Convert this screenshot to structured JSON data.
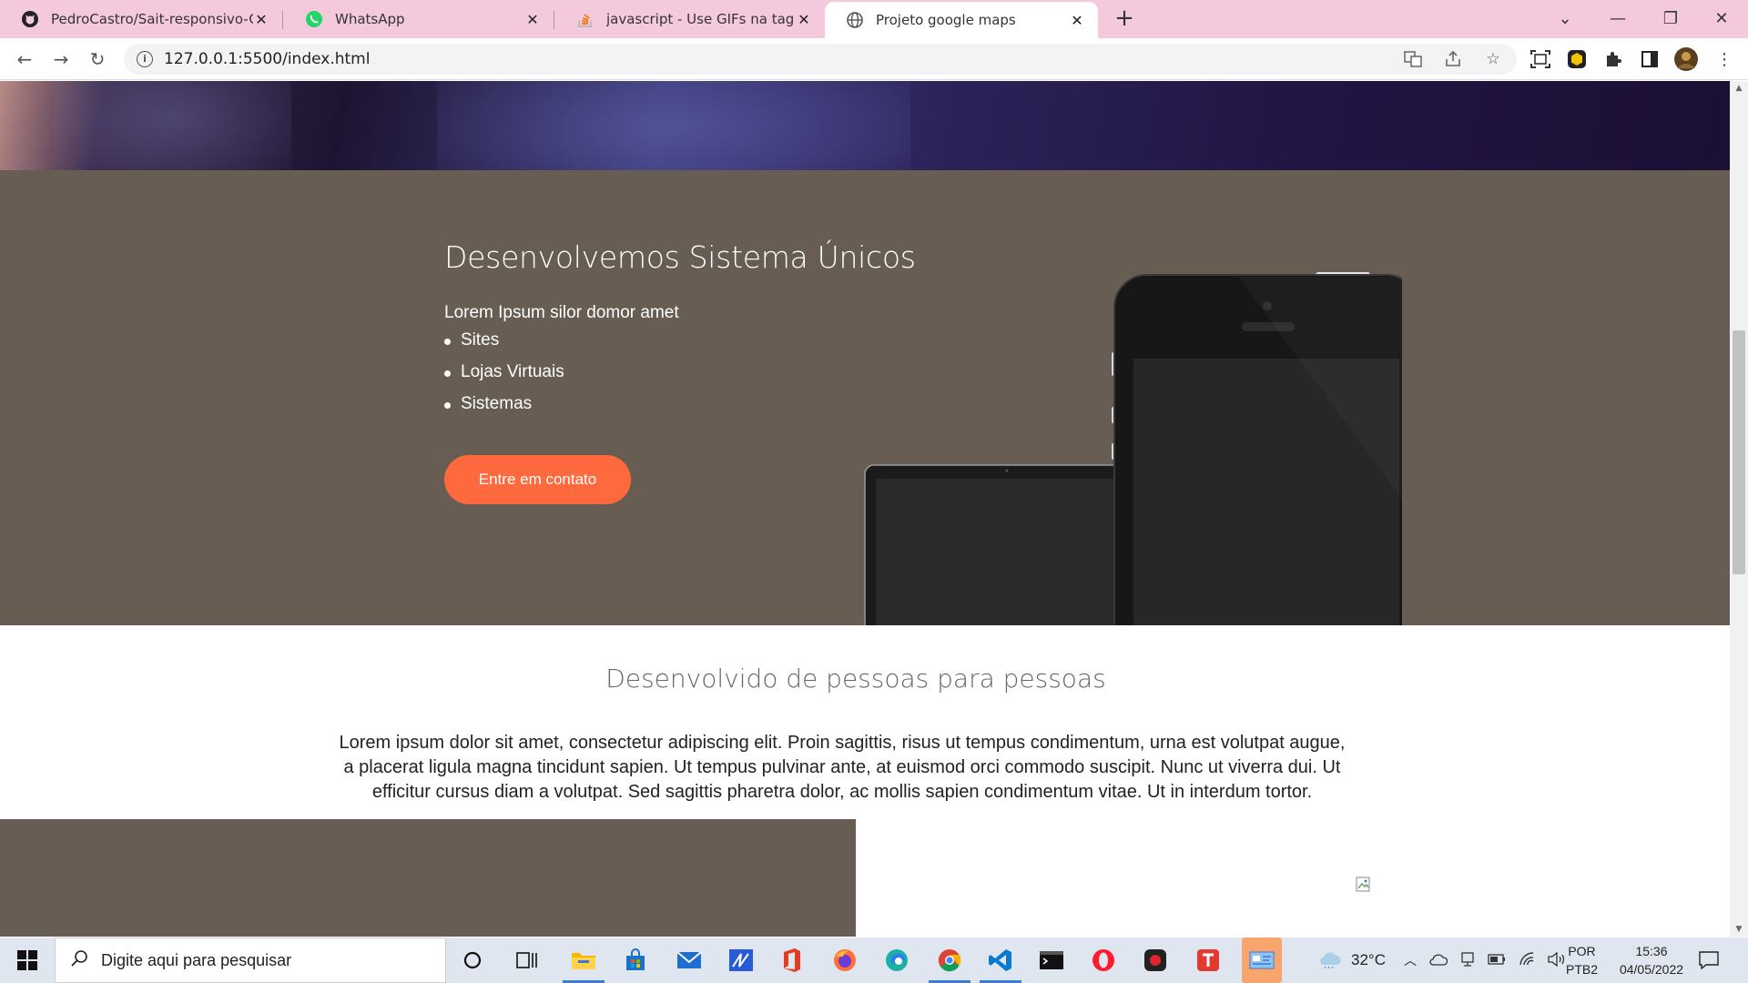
{
  "browser": {
    "tabs": [
      {
        "title": "PedroCastro/Sait-responsivo-Go",
        "icon": "github-icon"
      },
      {
        "title": "WhatsApp",
        "icon": "whatsapp-icon"
      },
      {
        "title": "javascript - Use GIFs na tag <vide",
        "icon": "stackoverflow-icon"
      },
      {
        "title": "Projeto google maps",
        "icon": "globe-icon",
        "active": true
      }
    ],
    "new_tab_label": "+",
    "url": "127.0.0.1:5500/index.html"
  },
  "page": {
    "services": {
      "title": "Desenvolvemos Sistema Únicos",
      "lead": "Lorem Ipsum silor domor amet",
      "items": [
        "Sites",
        "Lojas Virtuais",
        "Sistemas"
      ],
      "cta_label": "Entre em contato"
    },
    "about": {
      "title": "Desenvolvido de pessoas para pessoas",
      "paragraph": "Lorem ipsum dolor sit amet, consectetur adipiscing elit. Proin sagittis, risus ut tempus condimentum, urna est volutpat augue, a placerat ligula magna tincidunt sapien. Ut tempus pulvinar ante, at euismod orci commodo suscipit. Nunc ut viverra dui. Ut efficitur cursus diam a volutpat. Sed sagittis pharetra dolor, ac mollis sapien condimentum vitae. Ut in interdum tortor."
    }
  },
  "taskbar": {
    "search_placeholder": "Digite aqui para pesquisar",
    "weather": "32°C",
    "language": "POR",
    "layout": "PTB2",
    "time": "15:36",
    "date": "04/05/2022"
  },
  "colors": {
    "tab_strip": "#f4c9dc",
    "section_bg": "#675d52",
    "cta": "#fe6a3e"
  }
}
